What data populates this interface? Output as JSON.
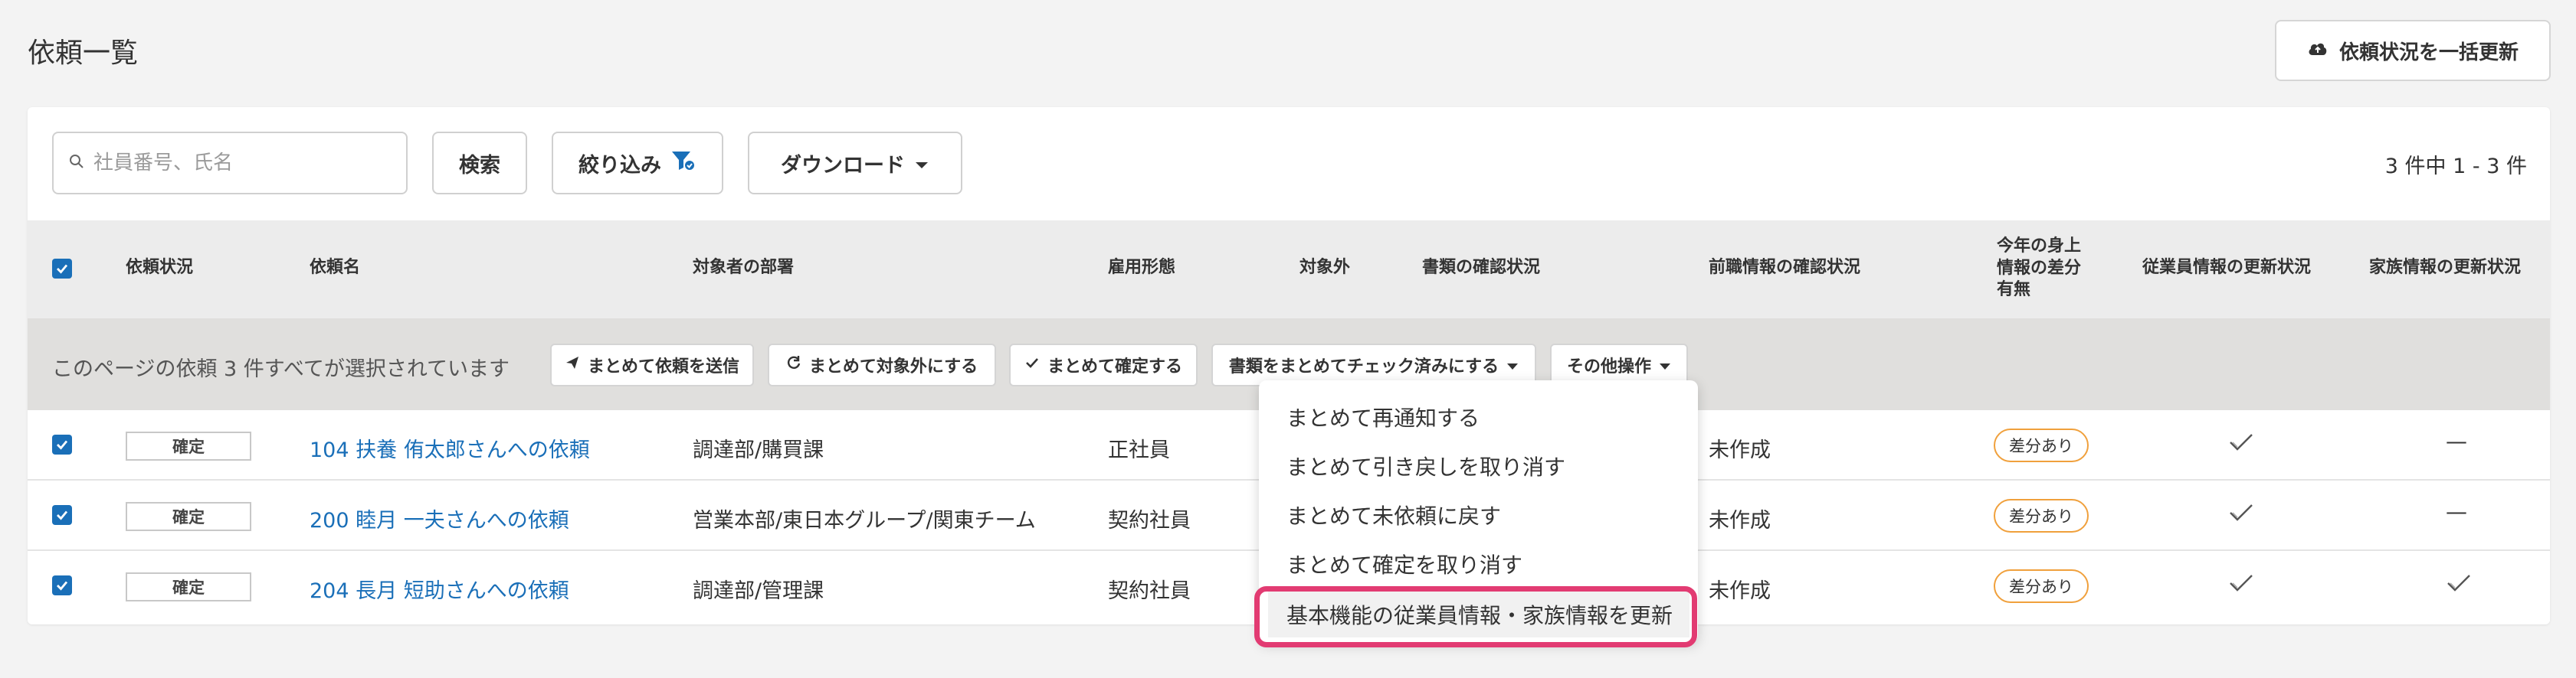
{
  "page": {
    "title": "依頼一覧",
    "bulk_update_label": "依頼状況を一括更新"
  },
  "toolbar": {
    "search_placeholder": "社員番号、氏名",
    "search_label": "検索",
    "filter_label": "絞り込み",
    "download_label": "ダウンロード",
    "count_text": "3 件中 1 - 3 件"
  },
  "table": {
    "headers": {
      "status": "依頼状況",
      "name": "依頼名",
      "dept": "対象者の部署",
      "employment": "雇用形態",
      "excluded": "対象外",
      "docs": "書類の確認状況",
      "prev_job": "前職情報の確認状況",
      "diff_l1": "今年の身上",
      "diff_l2": "情報の差分",
      "diff_l3": "有無",
      "emp_update": "従業員情報の更新状況",
      "family_update": "家族情報の更新状況"
    },
    "rows": [
      {
        "status": "確定",
        "name": "104 扶養 侑太郎さんへの依頼",
        "dept": "調達部/購買課",
        "employment": "正社員",
        "prev_job": "未作成",
        "diff": "差分あり",
        "family": "—"
      },
      {
        "status": "確定",
        "name": "200 睦月 一夫さんへの依頼",
        "dept": "営業本部/東日本グループ/関東チーム",
        "employment": "契約社員",
        "prev_job": "未作成",
        "diff": "差分あり",
        "family": "—"
      },
      {
        "status": "確定",
        "name": "204 長月 短助さんへの依頼",
        "dept": "調達部/管理課",
        "employment": "契約社員",
        "prev_job": "未作成",
        "diff": "差分あり",
        "family": ""
      }
    ]
  },
  "bulk": {
    "message": "このページの依頼 3 件すべてが選択されています",
    "send": "まとめて依頼を送信",
    "exclude": "まとめて対象外にする",
    "confirm": "まとめて確定する",
    "check_docs": "書類をまとめてチェック済みにする",
    "other": "その他操作"
  },
  "dropdown": {
    "items": [
      "まとめて再通知する",
      "まとめて引き戻しを取り消す",
      "まとめて未依頼に戻す",
      "まとめて確定を取り消す",
      "基本機能の従業員情報・家族情報を更新"
    ]
  },
  "colors": {
    "accent": "#1a6fb8",
    "badge": "#f0a03c",
    "highlight": "#e23b72"
  }
}
